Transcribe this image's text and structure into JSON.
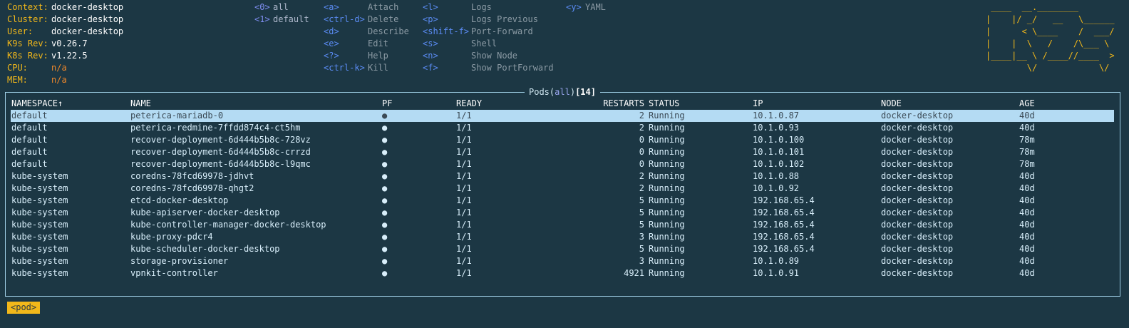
{
  "info": [
    {
      "label": "Context:",
      "value": "docker-desktop",
      "warn": false
    },
    {
      "label": "Cluster:",
      "value": "docker-desktop",
      "warn": false
    },
    {
      "label": "User:",
      "value": "docker-desktop",
      "warn": false
    },
    {
      "label": "K9s Rev:",
      "value": "v0.26.7",
      "warn": false
    },
    {
      "label": "K8s Rev:",
      "value": "v1.22.5",
      "warn": false
    },
    {
      "label": "CPU:",
      "value": "n/a",
      "warn": true
    },
    {
      "label": "MEM:",
      "value": "n/a",
      "warn": true
    }
  ],
  "namespaces": [
    {
      "key": "<0>",
      "name": "all"
    },
    {
      "key": "<1>",
      "name": "default"
    }
  ],
  "shortcuts_col1": [
    {
      "key": "<a>",
      "action": "Attach"
    },
    {
      "key": "<ctrl-d>",
      "action": "Delete"
    },
    {
      "key": "<d>",
      "action": "Describe"
    },
    {
      "key": "<e>",
      "action": "Edit"
    },
    {
      "key": "<?>",
      "action": "Help"
    },
    {
      "key": "<ctrl-k>",
      "action": "Kill"
    }
  ],
  "shortcuts_col2": [
    {
      "key": "<l>",
      "action": "Logs"
    },
    {
      "key": "<p>",
      "action": "Logs Previous"
    },
    {
      "key": "<shift-f>",
      "action": "Port-Forward"
    },
    {
      "key": "<s>",
      "action": "Shell"
    },
    {
      "key": "<n>",
      "action": "Show Node"
    },
    {
      "key": "<f>",
      "action": "Show PortForward"
    }
  ],
  "shortcuts_col3": [
    {
      "key": "<y>",
      "action": "YAML"
    }
  ],
  "logo_lines": [
    " ____  __.________       ",
    "|    |/ _/   __   \\______",
    "|      < \\____    /  ___/",
    "|    |  \\   /    /\\___ \\ ",
    "|____|__ \\ /____//____  >",
    "        \\/            \\/ "
  ],
  "panel": {
    "title": "Pods",
    "open_paren": "(",
    "filter": "all",
    "close_paren": ")",
    "count": "[14]"
  },
  "columns": [
    "NAMESPACE↑",
    "NAME",
    "PF",
    "READY",
    "RESTARTS",
    "STATUS",
    "IP",
    "NODE",
    "AGE"
  ],
  "pods": [
    {
      "namespace": "default",
      "name": "peterica-mariadb-0",
      "pf": "●",
      "ready": "1/1",
      "restarts": "2",
      "status": "Running",
      "ip": "10.1.0.87",
      "node": "docker-desktop",
      "age": "40d",
      "selected": true
    },
    {
      "namespace": "default",
      "name": "peterica-redmine-7ffdd874c4-ct5hm",
      "pf": "●",
      "ready": "1/1",
      "restarts": "2",
      "status": "Running",
      "ip": "10.1.0.93",
      "node": "docker-desktop",
      "age": "40d",
      "selected": false
    },
    {
      "namespace": "default",
      "name": "recover-deployment-6d444b5b8c-728vz",
      "pf": "●",
      "ready": "1/1",
      "restarts": "0",
      "status": "Running",
      "ip": "10.1.0.100",
      "node": "docker-desktop",
      "age": "78m",
      "selected": false
    },
    {
      "namespace": "default",
      "name": "recover-deployment-6d444b5b8c-crrzd",
      "pf": "●",
      "ready": "1/1",
      "restarts": "0",
      "status": "Running",
      "ip": "10.1.0.101",
      "node": "docker-desktop",
      "age": "78m",
      "selected": false
    },
    {
      "namespace": "default",
      "name": "recover-deployment-6d444b5b8c-l9qmc",
      "pf": "●",
      "ready": "1/1",
      "restarts": "0",
      "status": "Running",
      "ip": "10.1.0.102",
      "node": "docker-desktop",
      "age": "78m",
      "selected": false
    },
    {
      "namespace": "kube-system",
      "name": "coredns-78fcd69978-jdhvt",
      "pf": "●",
      "ready": "1/1",
      "restarts": "2",
      "status": "Running",
      "ip": "10.1.0.88",
      "node": "docker-desktop",
      "age": "40d",
      "selected": false
    },
    {
      "namespace": "kube-system",
      "name": "coredns-78fcd69978-qhgt2",
      "pf": "●",
      "ready": "1/1",
      "restarts": "2",
      "status": "Running",
      "ip": "10.1.0.92",
      "node": "docker-desktop",
      "age": "40d",
      "selected": false
    },
    {
      "namespace": "kube-system",
      "name": "etcd-docker-desktop",
      "pf": "●",
      "ready": "1/1",
      "restarts": "5",
      "status": "Running",
      "ip": "192.168.65.4",
      "node": "docker-desktop",
      "age": "40d",
      "selected": false
    },
    {
      "namespace": "kube-system",
      "name": "kube-apiserver-docker-desktop",
      "pf": "●",
      "ready": "1/1",
      "restarts": "5",
      "status": "Running",
      "ip": "192.168.65.4",
      "node": "docker-desktop",
      "age": "40d",
      "selected": false
    },
    {
      "namespace": "kube-system",
      "name": "kube-controller-manager-docker-desktop",
      "pf": "●",
      "ready": "1/1",
      "restarts": "5",
      "status": "Running",
      "ip": "192.168.65.4",
      "node": "docker-desktop",
      "age": "40d",
      "selected": false
    },
    {
      "namespace": "kube-system",
      "name": "kube-proxy-pdcr4",
      "pf": "●",
      "ready": "1/1",
      "restarts": "3",
      "status": "Running",
      "ip": "192.168.65.4",
      "node": "docker-desktop",
      "age": "40d",
      "selected": false
    },
    {
      "namespace": "kube-system",
      "name": "kube-scheduler-docker-desktop",
      "pf": "●",
      "ready": "1/1",
      "restarts": "5",
      "status": "Running",
      "ip": "192.168.65.4",
      "node": "docker-desktop",
      "age": "40d",
      "selected": false
    },
    {
      "namespace": "kube-system",
      "name": "storage-provisioner",
      "pf": "●",
      "ready": "1/1",
      "restarts": "3",
      "status": "Running",
      "ip": "10.1.0.89",
      "node": "docker-desktop",
      "age": "40d",
      "selected": false
    },
    {
      "namespace": "kube-system",
      "name": "vpnkit-controller",
      "pf": "●",
      "ready": "1/1",
      "restarts": "4921",
      "status": "Running",
      "ip": "10.1.0.91",
      "node": "docker-desktop",
      "age": "40d",
      "selected": false
    }
  ],
  "breadcrumb": "<pod>"
}
